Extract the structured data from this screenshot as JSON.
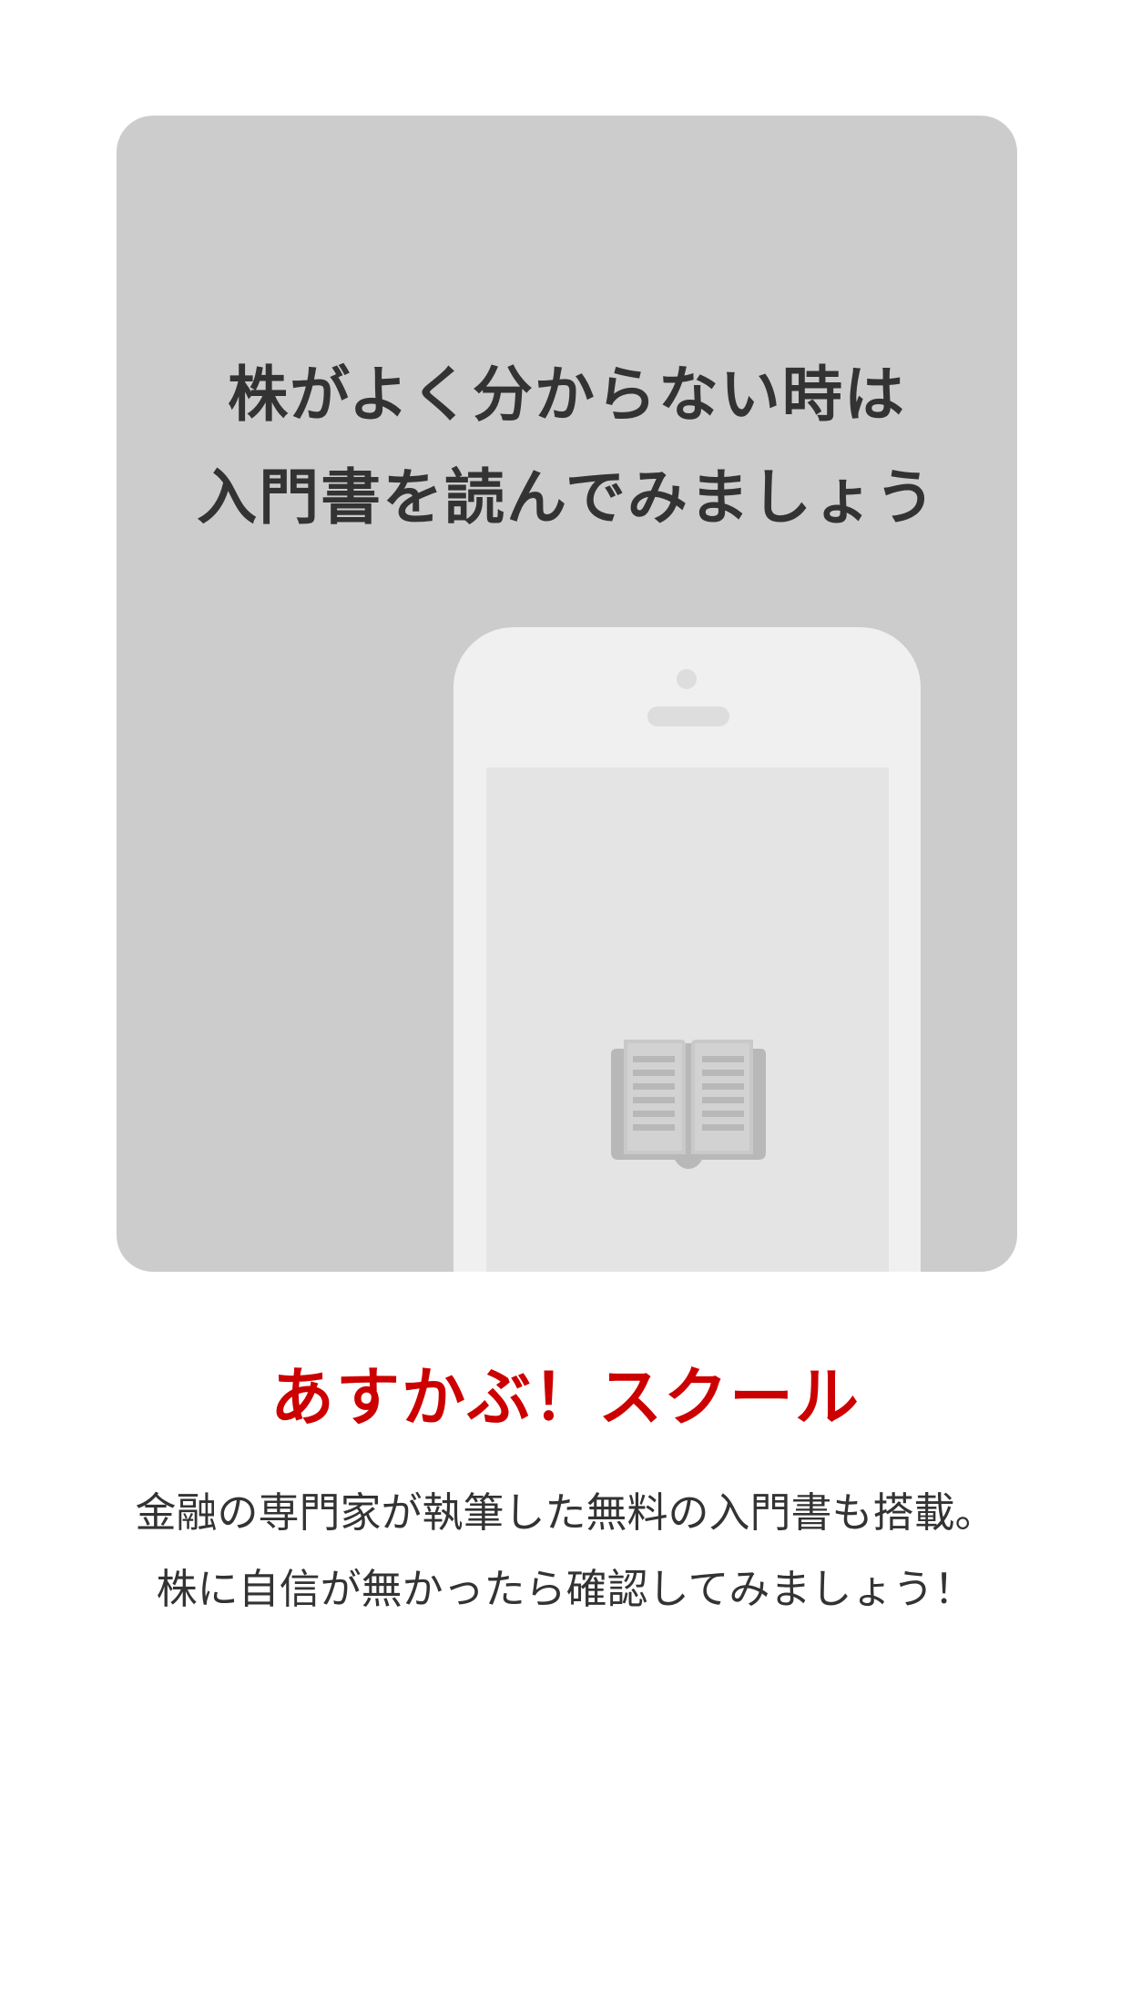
{
  "hero": {
    "title_line1": "株がよく分からない時は",
    "title_line2": "入門書を読んでみましょう",
    "phone_screen_icon": "open-book-icon",
    "card_color": "#cccccc"
  },
  "feature": {
    "title": "あすかぶ！スクール",
    "title_color": "#cc0000",
    "description_line1": "金融の専門家が執筆した無料の入門書も搭載。",
    "description_line2": "株に自信が無かったら確認してみましょう！"
  }
}
